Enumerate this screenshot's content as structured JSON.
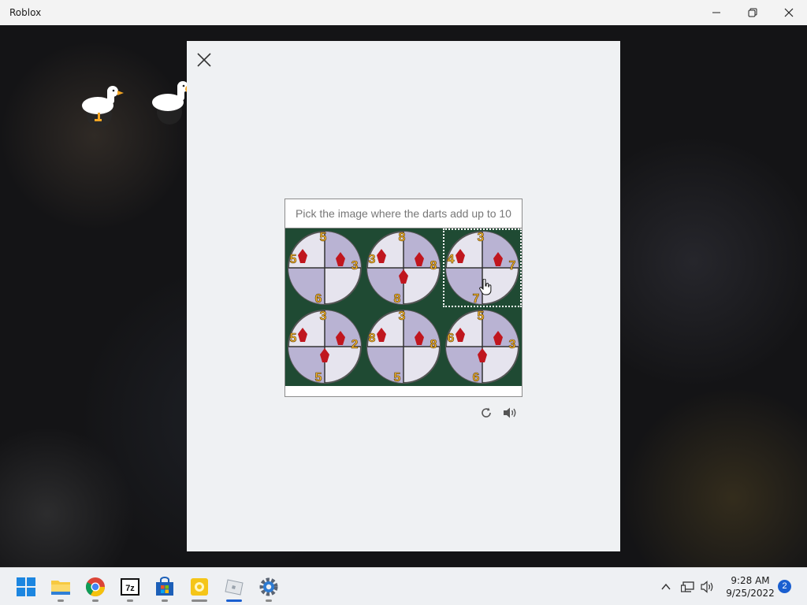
{
  "window": {
    "title": "Roblox"
  },
  "captcha": {
    "prompt": "Pick the image where the darts add up to 10",
    "tiles": [
      {
        "numbers": [
          "5",
          "5",
          "3",
          "6"
        ]
      },
      {
        "numbers": [
          "8",
          "3",
          "8",
          "8"
        ]
      },
      {
        "numbers": [
          "3",
          "4",
          "7",
          "7"
        ]
      },
      {
        "numbers": [
          "3",
          "5",
          "2",
          "5"
        ]
      },
      {
        "numbers": [
          "3",
          "8",
          "8",
          "5"
        ]
      },
      {
        "numbers": [
          "5",
          "6",
          "3",
          "6"
        ]
      }
    ],
    "selected_tile": 3
  },
  "taskbar": {
    "apps": [
      "start-icon",
      "file-explorer-icon",
      "chrome-icon",
      "7zip-icon",
      "microsoft-store-icon",
      "sticky-notes-icon",
      "roblox-icon",
      "settings-icon"
    ],
    "time": "9:28 AM",
    "date": "9/25/2022",
    "notification_count": "2"
  },
  "colors": {
    "accent": "#1a5fd0",
    "tile_bg": "#1f4a33",
    "dart_red": "#c0161e",
    "number_gold": "#f2b532"
  }
}
